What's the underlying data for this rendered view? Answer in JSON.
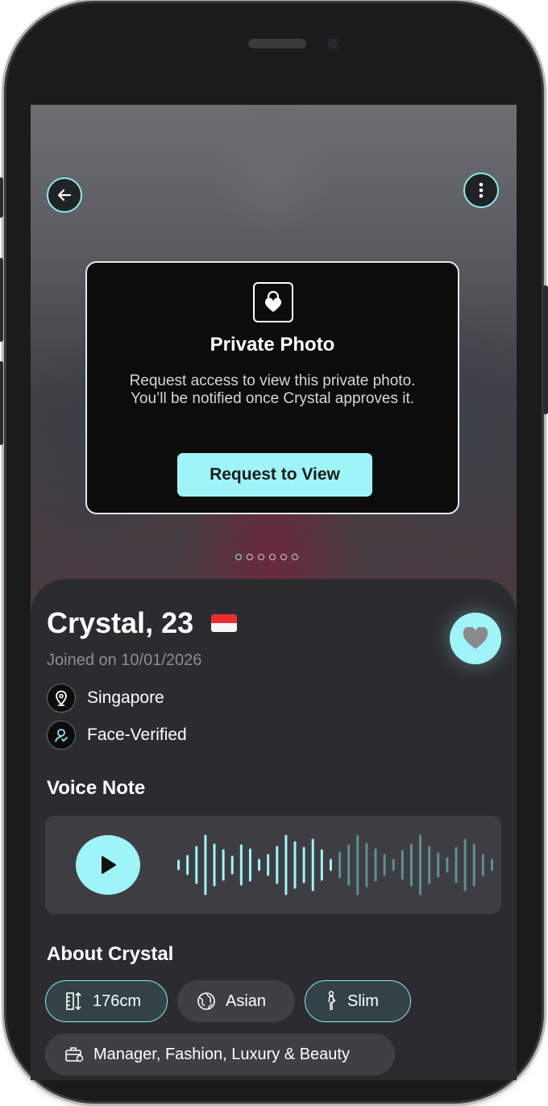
{
  "modal": {
    "title": "Private Photo",
    "text": "Request access to view this private photo. You’ll be notified once Crystal approves it.",
    "button": "Request to View"
  },
  "carousel": {
    "total": 6,
    "active": 1
  },
  "profile": {
    "name": "Crystal, 23",
    "country_flag": "singapore-flag",
    "joined": "Joined on 10/01/2026",
    "location": "Singapore",
    "verification": "Face-Verified"
  },
  "voice_note": {
    "title": "Voice Note",
    "played_fraction": 0.5
  },
  "about": {
    "title": "About Crystal",
    "chips": [
      {
        "label": "176cm",
        "icon": "height-icon",
        "highlighted": true
      },
      {
        "label": "Asian",
        "icon": "globe-icon",
        "highlighted": false
      },
      {
        "label": "Slim",
        "icon": "body-type-icon",
        "highlighted": true
      },
      {
        "label": "Manager, Fashion, Luxury & Beauty",
        "icon": "briefcase-icon",
        "highlighted": false
      }
    ]
  },
  "colors": {
    "accent": "#9ff4f8",
    "sheet": "#2c2c30",
    "card": "#3d3d42"
  }
}
